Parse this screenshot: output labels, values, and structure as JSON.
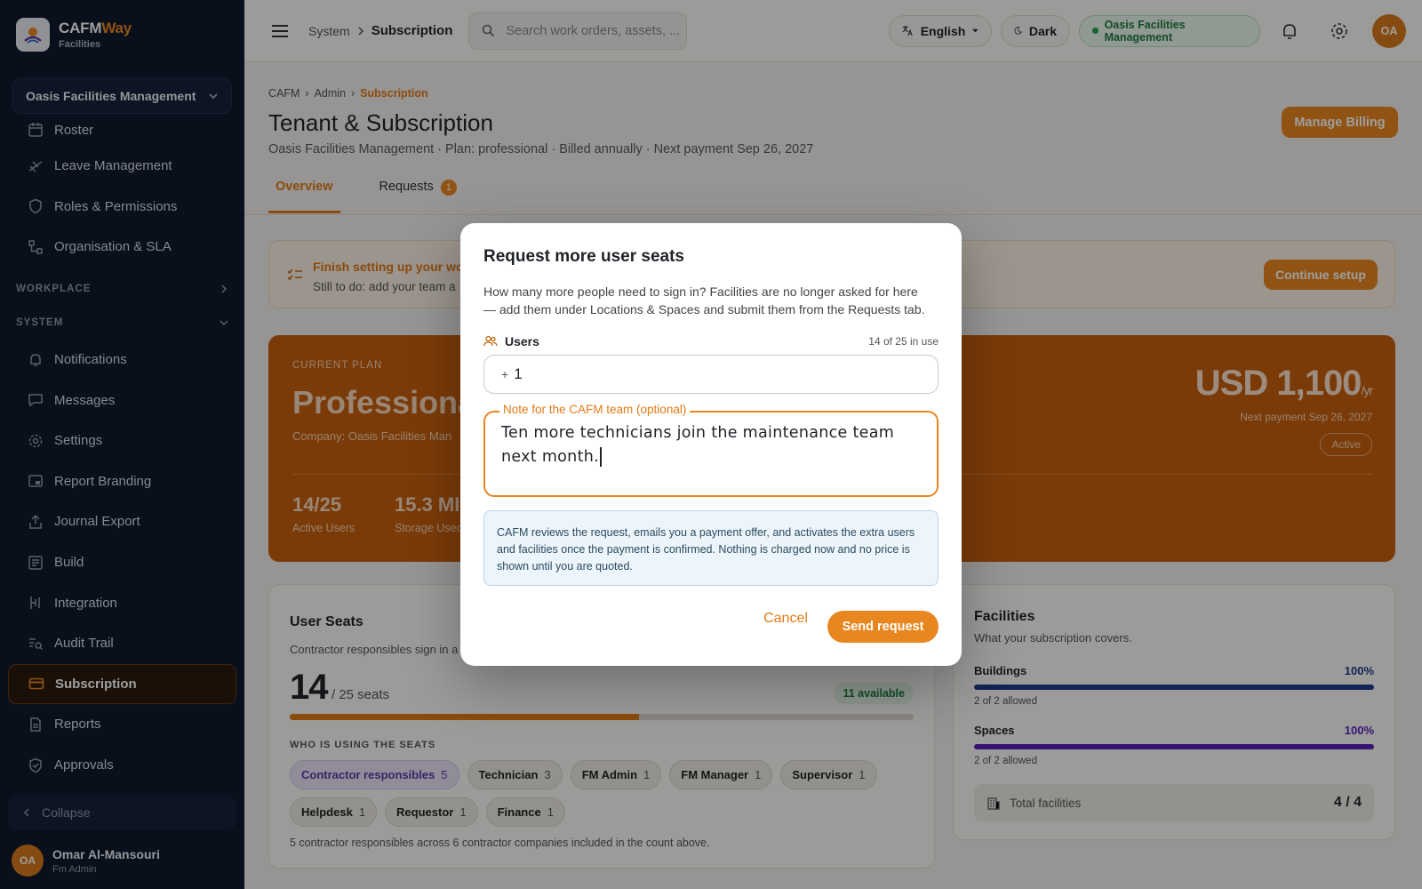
{
  "brand": {
    "name_a": "CAFM",
    "name_b": "Way",
    "sub": "Facilities"
  },
  "org_select": {
    "value": "Oasis Facilities Management"
  },
  "nav_top": [
    {
      "label": "Roster",
      "icon": "calendar-icon"
    },
    {
      "label": "Leave Management",
      "icon": "plane-icon"
    },
    {
      "label": "Roles & Permissions",
      "icon": "shield-icon"
    },
    {
      "label": "Organisation & SLA",
      "icon": "org-chart-icon"
    }
  ],
  "sections": {
    "workplace": "WORKPLACE",
    "system": "SYSTEM"
  },
  "nav_system": [
    {
      "label": "Notifications",
      "icon": "bell-icon"
    },
    {
      "label": "Messages",
      "icon": "message-icon"
    },
    {
      "label": "Settings",
      "icon": "gear-icon"
    },
    {
      "label": "Report Branding",
      "icon": "branding-icon"
    },
    {
      "label": "Journal Export",
      "icon": "export-icon"
    },
    {
      "label": "Build",
      "icon": "build-icon"
    },
    {
      "label": "Integration",
      "icon": "integration-icon"
    },
    {
      "label": "Audit Trail",
      "icon": "audit-icon"
    },
    {
      "label": "Subscription",
      "icon": "card-icon",
      "active": true
    },
    {
      "label": "Reports",
      "icon": "report-icon"
    },
    {
      "label": "Approvals",
      "icon": "approval-shield-icon"
    }
  ],
  "collapse_label": "Collapse",
  "user": {
    "initials": "OA",
    "name": "Omar Al-Mansouri",
    "role": "Fm Admin"
  },
  "topbar": {
    "crumb_parent": "System",
    "crumb_current": "Subscription",
    "search_placeholder": "Search work orders, assets, ...",
    "language": "English",
    "theme": "Dark",
    "org": "Oasis Facilities Management",
    "avatar": "OA"
  },
  "page": {
    "crumbs": [
      "CAFM",
      "Admin",
      "Subscription"
    ],
    "title": "Tenant & Subscription",
    "subtitle": "Oasis Facilities Management · Plan: professional · Billed annually · Next payment Sep 26, 2027",
    "manage_billing": "Manage Billing",
    "tabs": [
      {
        "label": "Overview"
      },
      {
        "label": "Requests",
        "badge": "1"
      }
    ]
  },
  "setup": {
    "title": "Finish setting up your wo",
    "text": "Still to do: add your team a",
    "button": "Continue setup"
  },
  "plan": {
    "label": "CURRENT PLAN",
    "name": "Professional",
    "company": "Company: Oasis Facilities Man",
    "price": "USD 1,100",
    "per": "/yr",
    "next": "Next payment Sep 26, 2027",
    "status": "Active",
    "stats": [
      {
        "value": "14/25",
        "label": "Active Users"
      },
      {
        "value": "15.3 MI",
        "label": "Storage Usec"
      }
    ]
  },
  "seats": {
    "title": "User Seats",
    "subtitle": "Contractor responsibles sign in a",
    "used": "14",
    "of": "/ 25 seats",
    "available": "11 available",
    "fill_fraction": 0.56,
    "who_label": "WHO IS USING THE SEATS",
    "chips": [
      {
        "label": "Contractor responsibles",
        "count": "5"
      },
      {
        "label": "Technician",
        "count": "3"
      },
      {
        "label": "FM Admin",
        "count": "1"
      },
      {
        "label": "FM Manager",
        "count": "1"
      },
      {
        "label": "Supervisor",
        "count": "1"
      },
      {
        "label": "Helpdesk",
        "count": "1"
      },
      {
        "label": "Requestor",
        "count": "1"
      },
      {
        "label": "Finance",
        "count": "1"
      }
    ],
    "footer": "5 contractor responsibles across 6 contractor companies included in the count above."
  },
  "facilities": {
    "title": "Facilities",
    "subtitle": "What your subscription covers.",
    "rows": [
      {
        "label": "Buildings",
        "pct": "100%",
        "fraction": 1.0,
        "sub": "2 of 2 allowed",
        "color": "#1e3a8a"
      },
      {
        "label": "Spaces",
        "pct": "100%",
        "fraction": 1.0,
        "sub": "2 of 2 allowed",
        "color": "#5b21b6"
      }
    ],
    "total_label": "Total facilities",
    "total_value": "4 / 4"
  },
  "modal": {
    "title": "Request more user seats",
    "description": "How many more people need to sign in? Facilities are no longer asked for here — add them under Locations & Spaces and submit them from the Requests tab.",
    "users_label": "Users",
    "in_use": "14 of 25 in use",
    "plus": "+",
    "users_value": "1",
    "note_label": "Note for the CAFM team (optional)",
    "note_value": "Ten more technicians join the maintenance team next month.",
    "info": "CAFM reviews the request, emails you a payment offer, and activates the extra users and facilities once the payment is confirmed. Nothing is charged now and no price is shown until you are quoted.",
    "cancel": "Cancel",
    "send": "Send request"
  }
}
